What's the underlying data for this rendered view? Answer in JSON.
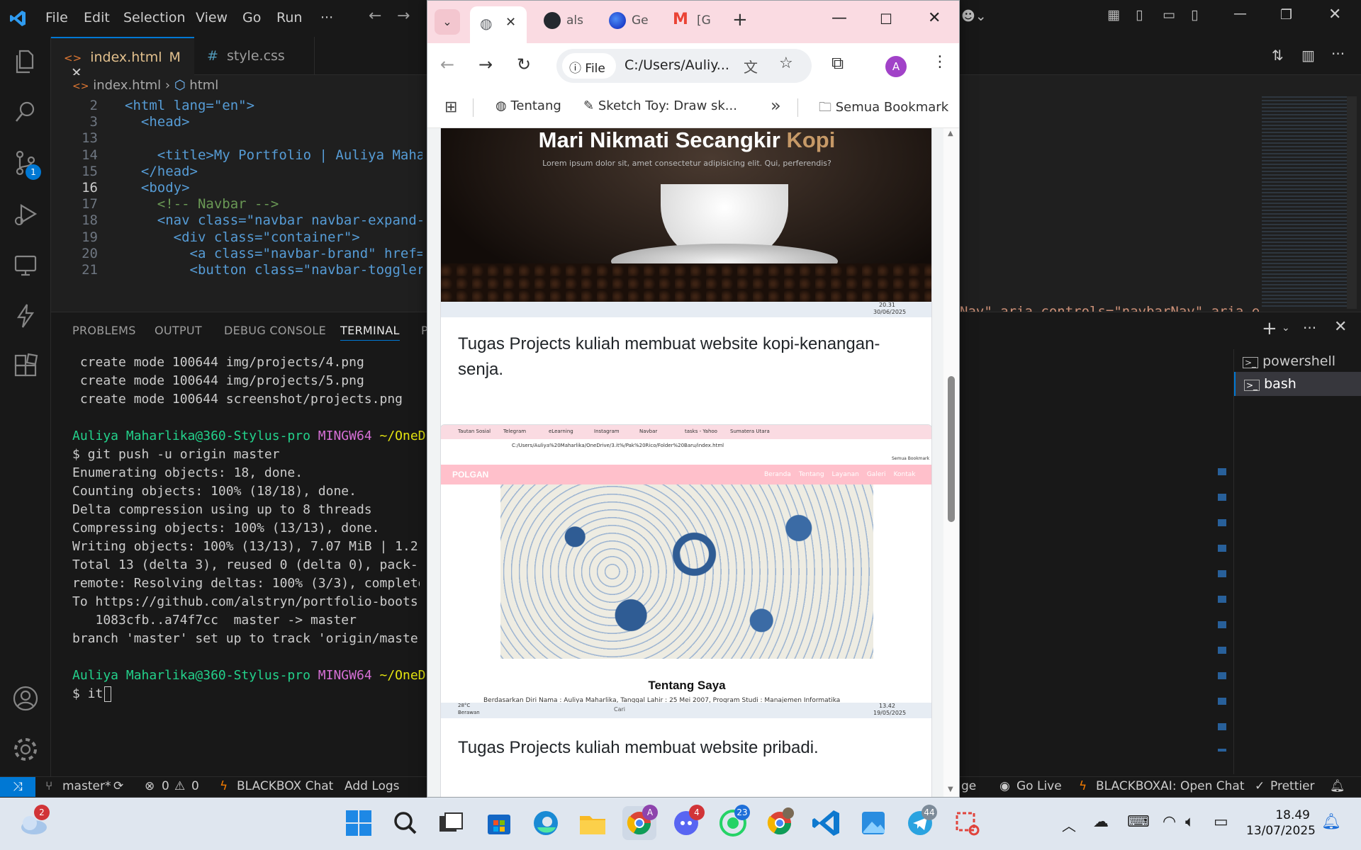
{
  "vscode": {
    "menu": [
      "File",
      "Edit",
      "Selection",
      "View",
      "Go",
      "Run",
      "···"
    ],
    "tabs": [
      {
        "icon": "<>",
        "label": "index.html",
        "status": "M"
      },
      {
        "icon": "#",
        "label": "style.css"
      }
    ],
    "breadcrumb": {
      "file": "index.html",
      "node": "html"
    },
    "code_lines": [
      {
        "n": "2",
        "text": "<html lang=\"en\">"
      },
      {
        "n": "3",
        "text": "  <head>"
      },
      {
        "n": "13",
        "text": ""
      },
      {
        "n": "14",
        "text": "    <title>My Portfolio | Auliya Maha"
      },
      {
        "n": "15",
        "text": "  </head>"
      },
      {
        "n": "16",
        "text": "  <body>"
      },
      {
        "n": "17",
        "text": "    <!-- Navbar -->"
      },
      {
        "n": "18",
        "text": "    <nav class=\"navbar navbar-expand-"
      },
      {
        "n": "19",
        "text": "      <div class=\"container\">"
      },
      {
        "n": "20",
        "text": "        <a class=\"navbar-brand\" href="
      },
      {
        "n": "21",
        "text": "        <button class=\"navbar-toggler"
      }
    ],
    "code_overflow_right": "Nav\" aria-controls=\"navbarNav\" aria-e",
    "panel_tabs": [
      "PROBLEMS",
      "OUTPUT",
      "DEBUG CONSOLE",
      "TERMINAL",
      "P"
    ],
    "terminal_lines": [
      " create mode 100644 img/projects/4.png",
      " create mode 100644 img/projects/5.png",
      " create mode 100644 screenshot/projects.png",
      "",
      "$ git push -u origin master",
      "Enumerating objects: 18, done.",
      "Counting objects: 100% (18/18), done.",
      "Delta compression using up to 8 threads",
      "Compressing objects: 100% (13/13), done.",
      "Writing objects: 100% (13/13), 7.07 MiB | 1.2",
      "Total 13 (delta 3), reused 0 (delta 0), pack-",
      "remote: Resolving deltas: 100% (3/3), complete",
      "To https://github.com/alstryn/portfolio-boots",
      "   1083cfb..a74f7cc  master -> master",
      "branch 'master' set up to track 'origin/master",
      "",
      "$ it"
    ],
    "prompt_user": "Auliya Maharlika@360-Stylus-pro",
    "prompt_env": "MINGW64",
    "prompt_path": "~/OneD",
    "terminals": [
      "powershell",
      "bash"
    ],
    "status": {
      "branch": "master*",
      "errors": "0",
      "warnings": "0",
      "blackbox": "BLACKBOX Chat",
      "add_logs": "Add Logs",
      "ge": "ge",
      "go_live": "Go Live",
      "blackbox_open": "BLACKBOXAI: Open Chat",
      "prettier": "Prettier"
    },
    "accent": "#0078d4",
    "scm_badge": "1"
  },
  "chrome": {
    "tabs": [
      {
        "label": "als"
      },
      {
        "label": "Ge"
      },
      {
        "label": "[G"
      }
    ],
    "address_prefix": "File",
    "address": "C:/Users/Auliy...",
    "profile_initial": "A",
    "bookmarks": [
      {
        "label": "Tentang"
      },
      {
        "label": "Sketch Toy: Draw sk..."
      }
    ],
    "bookmarks_more": "»",
    "all_bookmarks": "Semua Bookmark",
    "card1": {
      "hero_title_white": "Mari Nikmati Secangkir",
      "hero_title_accent": "Kopi",
      "hero_subtitle": "Lorem ipsum dolor sit, amet consectetur adipisicing elit. Qui, perferendis?",
      "time": "20.31",
      "date": "30/06/2025",
      "text": "Tugas Projects kuliah membuat website kopi-kenangan-senja."
    },
    "card2": {
      "navbar_brand": "POLGAN",
      "nav_links": [
        "Beranda",
        "Tentang",
        "Layanan",
        "Galeri",
        "Kontak"
      ],
      "mini_address": "C:/Users/Auliya%20Maharlika/OneDrive/3.it%/Pak%20Rico/Folder%20Baru/index.html",
      "mini_tabs": [
        "Tautan Sosial",
        "Telegram",
        "eLearning",
        "Instagram",
        "Navbar",
        "tasks - Yahoo",
        "Sumatera Utara"
      ],
      "mini_bookmark": "Semua Bookmark",
      "section_title": "Tentang Saya",
      "section_text": "Berdasarkan Diri Nama : Auliya Maharlika, Tanggal Lahir : 25 Mei 2007, Program Studi : Manajemen Informatika",
      "weather": "28°C",
      "weather_desc": "Berawan",
      "search": "Cari",
      "time": "13.42",
      "date": "19/05/2025",
      "text": "Tugas Projects kuliah membuat website pribadi."
    }
  },
  "taskbar": {
    "weather_badge": "2",
    "chrome_badge": "A",
    "discord_badge": "4",
    "whatsapp_badge": "23",
    "telegram_badge": "44",
    "time": "18.49",
    "date": "13/07/2025"
  }
}
